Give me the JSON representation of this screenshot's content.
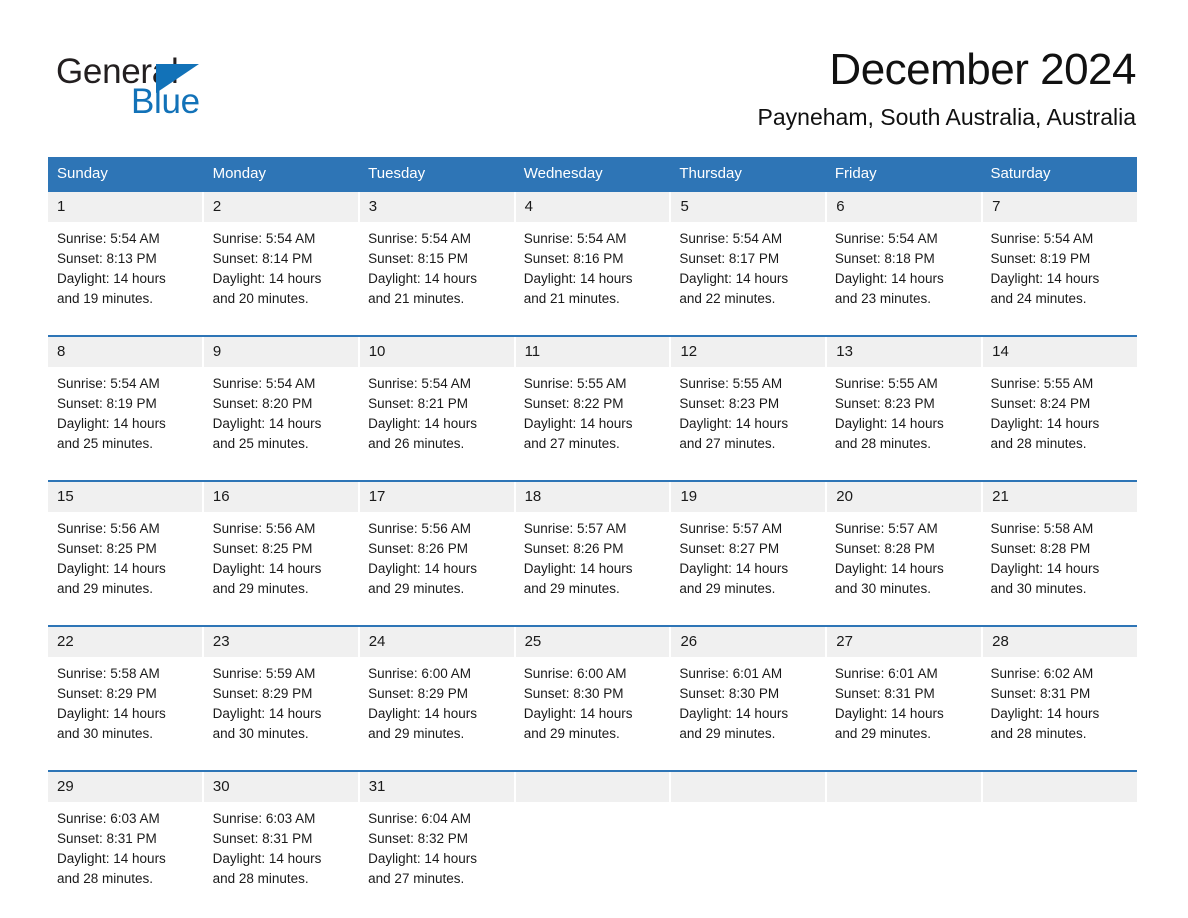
{
  "brand": {
    "name_part1": "General",
    "name_part2": "Blue",
    "triangle_icon": "blue-triangle-icon",
    "accent_color": "#1272b8"
  },
  "header": {
    "title": "December 2024",
    "location": "Payneham, South Australia, Australia"
  },
  "theme": {
    "header_blue": "#2e75b6",
    "date_strip_gray": "#f0f0f0",
    "text_color": "#1a1a1a"
  },
  "weekdays": [
    "Sunday",
    "Monday",
    "Tuesday",
    "Wednesday",
    "Thursday",
    "Friday",
    "Saturday"
  ],
  "weeks": [
    {
      "days": [
        {
          "date": "1",
          "sunrise": "Sunrise: 5:54 AM",
          "sunset": "Sunset: 8:13 PM",
          "daylight_line1": "Daylight: 14 hours",
          "daylight_line2": "and 19 minutes."
        },
        {
          "date": "2",
          "sunrise": "Sunrise: 5:54 AM",
          "sunset": "Sunset: 8:14 PM",
          "daylight_line1": "Daylight: 14 hours",
          "daylight_line2": "and 20 minutes."
        },
        {
          "date": "3",
          "sunrise": "Sunrise: 5:54 AM",
          "sunset": "Sunset: 8:15 PM",
          "daylight_line1": "Daylight: 14 hours",
          "daylight_line2": "and 21 minutes."
        },
        {
          "date": "4",
          "sunrise": "Sunrise: 5:54 AM",
          "sunset": "Sunset: 8:16 PM",
          "daylight_line1": "Daylight: 14 hours",
          "daylight_line2": "and 21 minutes."
        },
        {
          "date": "5",
          "sunrise": "Sunrise: 5:54 AM",
          "sunset": "Sunset: 8:17 PM",
          "daylight_line1": "Daylight: 14 hours",
          "daylight_line2": "and 22 minutes."
        },
        {
          "date": "6",
          "sunrise": "Sunrise: 5:54 AM",
          "sunset": "Sunset: 8:18 PM",
          "daylight_line1": "Daylight: 14 hours",
          "daylight_line2": "and 23 minutes."
        },
        {
          "date": "7",
          "sunrise": "Sunrise: 5:54 AM",
          "sunset": "Sunset: 8:19 PM",
          "daylight_line1": "Daylight: 14 hours",
          "daylight_line2": "and 24 minutes."
        }
      ]
    },
    {
      "days": [
        {
          "date": "8",
          "sunrise": "Sunrise: 5:54 AM",
          "sunset": "Sunset: 8:19 PM",
          "daylight_line1": "Daylight: 14 hours",
          "daylight_line2": "and 25 minutes."
        },
        {
          "date": "9",
          "sunrise": "Sunrise: 5:54 AM",
          "sunset": "Sunset: 8:20 PM",
          "daylight_line1": "Daylight: 14 hours",
          "daylight_line2": "and 25 minutes."
        },
        {
          "date": "10",
          "sunrise": "Sunrise: 5:54 AM",
          "sunset": "Sunset: 8:21 PM",
          "daylight_line1": "Daylight: 14 hours",
          "daylight_line2": "and 26 minutes."
        },
        {
          "date": "11",
          "sunrise": "Sunrise: 5:55 AM",
          "sunset": "Sunset: 8:22 PM",
          "daylight_line1": "Daylight: 14 hours",
          "daylight_line2": "and 27 minutes."
        },
        {
          "date": "12",
          "sunrise": "Sunrise: 5:55 AM",
          "sunset": "Sunset: 8:23 PM",
          "daylight_line1": "Daylight: 14 hours",
          "daylight_line2": "and 27 minutes."
        },
        {
          "date": "13",
          "sunrise": "Sunrise: 5:55 AM",
          "sunset": "Sunset: 8:23 PM",
          "daylight_line1": "Daylight: 14 hours",
          "daylight_line2": "and 28 minutes."
        },
        {
          "date": "14",
          "sunrise": "Sunrise: 5:55 AM",
          "sunset": "Sunset: 8:24 PM",
          "daylight_line1": "Daylight: 14 hours",
          "daylight_line2": "and 28 minutes."
        }
      ]
    },
    {
      "days": [
        {
          "date": "15",
          "sunrise": "Sunrise: 5:56 AM",
          "sunset": "Sunset: 8:25 PM",
          "daylight_line1": "Daylight: 14 hours",
          "daylight_line2": "and 29 minutes."
        },
        {
          "date": "16",
          "sunrise": "Sunrise: 5:56 AM",
          "sunset": "Sunset: 8:25 PM",
          "daylight_line1": "Daylight: 14 hours",
          "daylight_line2": "and 29 minutes."
        },
        {
          "date": "17",
          "sunrise": "Sunrise: 5:56 AM",
          "sunset": "Sunset: 8:26 PM",
          "daylight_line1": "Daylight: 14 hours",
          "daylight_line2": "and 29 minutes."
        },
        {
          "date": "18",
          "sunrise": "Sunrise: 5:57 AM",
          "sunset": "Sunset: 8:26 PM",
          "daylight_line1": "Daylight: 14 hours",
          "daylight_line2": "and 29 minutes."
        },
        {
          "date": "19",
          "sunrise": "Sunrise: 5:57 AM",
          "sunset": "Sunset: 8:27 PM",
          "daylight_line1": "Daylight: 14 hours",
          "daylight_line2": "and 29 minutes."
        },
        {
          "date": "20",
          "sunrise": "Sunrise: 5:57 AM",
          "sunset": "Sunset: 8:28 PM",
          "daylight_line1": "Daylight: 14 hours",
          "daylight_line2": "and 30 minutes."
        },
        {
          "date": "21",
          "sunrise": "Sunrise: 5:58 AM",
          "sunset": "Sunset: 8:28 PM",
          "daylight_line1": "Daylight: 14 hours",
          "daylight_line2": "and 30 minutes."
        }
      ]
    },
    {
      "days": [
        {
          "date": "22",
          "sunrise": "Sunrise: 5:58 AM",
          "sunset": "Sunset: 8:29 PM",
          "daylight_line1": "Daylight: 14 hours",
          "daylight_line2": "and 30 minutes."
        },
        {
          "date": "23",
          "sunrise": "Sunrise: 5:59 AM",
          "sunset": "Sunset: 8:29 PM",
          "daylight_line1": "Daylight: 14 hours",
          "daylight_line2": "and 30 minutes."
        },
        {
          "date": "24",
          "sunrise": "Sunrise: 6:00 AM",
          "sunset": "Sunset: 8:29 PM",
          "daylight_line1": "Daylight: 14 hours",
          "daylight_line2": "and 29 minutes."
        },
        {
          "date": "25",
          "sunrise": "Sunrise: 6:00 AM",
          "sunset": "Sunset: 8:30 PM",
          "daylight_line1": "Daylight: 14 hours",
          "daylight_line2": "and 29 minutes."
        },
        {
          "date": "26",
          "sunrise": "Sunrise: 6:01 AM",
          "sunset": "Sunset: 8:30 PM",
          "daylight_line1": "Daylight: 14 hours",
          "daylight_line2": "and 29 minutes."
        },
        {
          "date": "27",
          "sunrise": "Sunrise: 6:01 AM",
          "sunset": "Sunset: 8:31 PM",
          "daylight_line1": "Daylight: 14 hours",
          "daylight_line2": "and 29 minutes."
        },
        {
          "date": "28",
          "sunrise": "Sunrise: 6:02 AM",
          "sunset": "Sunset: 8:31 PM",
          "daylight_line1": "Daylight: 14 hours",
          "daylight_line2": "and 28 minutes."
        }
      ]
    },
    {
      "days": [
        {
          "date": "29",
          "sunrise": "Sunrise: 6:03 AM",
          "sunset": "Sunset: 8:31 PM",
          "daylight_line1": "Daylight: 14 hours",
          "daylight_line2": "and 28 minutes."
        },
        {
          "date": "30",
          "sunrise": "Sunrise: 6:03 AM",
          "sunset": "Sunset: 8:31 PM",
          "daylight_line1": "Daylight: 14 hours",
          "daylight_line2": "and 28 minutes."
        },
        {
          "date": "31",
          "sunrise": "Sunrise: 6:04 AM",
          "sunset": "Sunset: 8:32 PM",
          "daylight_line1": "Daylight: 14 hours",
          "daylight_line2": "and 27 minutes."
        },
        {
          "date": "",
          "sunrise": "",
          "sunset": "",
          "daylight_line1": "",
          "daylight_line2": ""
        },
        {
          "date": "",
          "sunrise": "",
          "sunset": "",
          "daylight_line1": "",
          "daylight_line2": ""
        },
        {
          "date": "",
          "sunrise": "",
          "sunset": "",
          "daylight_line1": "",
          "daylight_line2": ""
        },
        {
          "date": "",
          "sunrise": "",
          "sunset": "",
          "daylight_line1": "",
          "daylight_line2": ""
        }
      ]
    }
  ]
}
